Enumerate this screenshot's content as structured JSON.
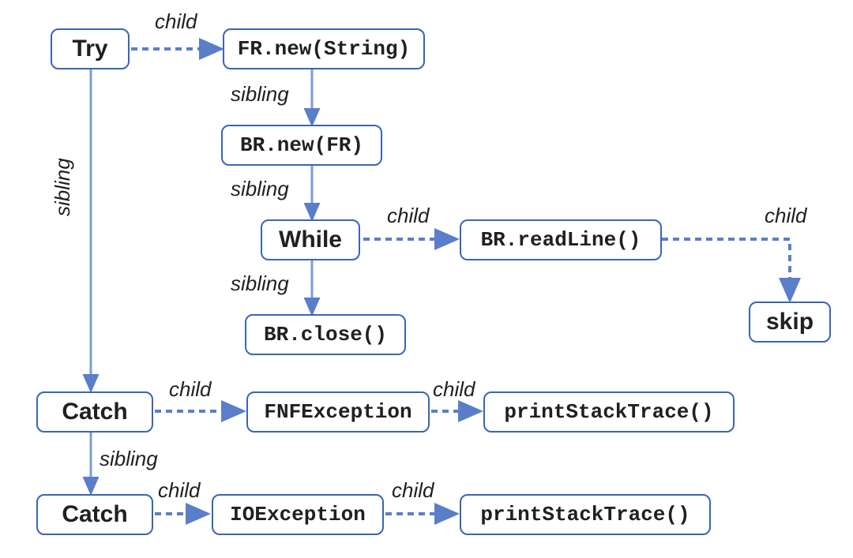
{
  "nodes": {
    "try": "Try",
    "frnew": "FR.new(String)",
    "brnew": "BR.new(FR)",
    "while": "While",
    "readline": "BR.readLine()",
    "skip": "skip",
    "brclose": "BR.close()",
    "catch1": "Catch",
    "fnf": "FNFException",
    "pst1": "printStackTrace()",
    "catch2": "Catch",
    "ioex": "IOException",
    "pst2": "printStackTrace()"
  },
  "edges": {
    "e_try_frnew": "child",
    "e_frnew_brnew": "sibling",
    "e_brnew_while": "sibling",
    "e_while_readline": "child",
    "e_readline_skip": "child",
    "e_while_brclose": "sibling",
    "e_try_catch1": "sibling",
    "e_catch1_fnf": "child",
    "e_fnf_pst1": "child",
    "e_catch1_catch2": "sibling",
    "e_catch2_ioex": "child",
    "e_ioex_pst2": "child"
  },
  "colors": {
    "arrow": "#5a7ec9",
    "arrow_light": "#7d9add"
  },
  "chart_data": {
    "type": "graph",
    "title": "",
    "nodes": [
      {
        "id": "try",
        "label": "Try",
        "kind": "keyword"
      },
      {
        "id": "frnew",
        "label": "FR.new(String)",
        "kind": "call"
      },
      {
        "id": "brnew",
        "label": "BR.new(FR)",
        "kind": "call"
      },
      {
        "id": "while",
        "label": "While",
        "kind": "keyword"
      },
      {
        "id": "readline",
        "label": "BR.readLine()",
        "kind": "call"
      },
      {
        "id": "skip",
        "label": "skip",
        "kind": "keyword"
      },
      {
        "id": "brclose",
        "label": "BR.close()",
        "kind": "call"
      },
      {
        "id": "catch1",
        "label": "Catch",
        "kind": "keyword"
      },
      {
        "id": "fnf",
        "label": "FNFException",
        "kind": "type"
      },
      {
        "id": "pst1",
        "label": "printStackTrace()",
        "kind": "call"
      },
      {
        "id": "catch2",
        "label": "Catch",
        "kind": "keyword"
      },
      {
        "id": "ioex",
        "label": "IOException",
        "kind": "type"
      },
      {
        "id": "pst2",
        "label": "printStackTrace()",
        "kind": "call"
      }
    ],
    "edges": [
      {
        "from": "try",
        "to": "frnew",
        "label": "child",
        "style": "dashed"
      },
      {
        "from": "frnew",
        "to": "brnew",
        "label": "sibling",
        "style": "solid"
      },
      {
        "from": "brnew",
        "to": "while",
        "label": "sibling",
        "style": "solid"
      },
      {
        "from": "while",
        "to": "readline",
        "label": "child",
        "style": "dashed"
      },
      {
        "from": "readline",
        "to": "skip",
        "label": "child",
        "style": "dashed"
      },
      {
        "from": "while",
        "to": "brclose",
        "label": "sibling",
        "style": "solid"
      },
      {
        "from": "try",
        "to": "catch1",
        "label": "sibling",
        "style": "solid"
      },
      {
        "from": "catch1",
        "to": "fnf",
        "label": "child",
        "style": "dashed"
      },
      {
        "from": "fnf",
        "to": "pst1",
        "label": "child",
        "style": "dashed"
      },
      {
        "from": "catch1",
        "to": "catch2",
        "label": "sibling",
        "style": "solid"
      },
      {
        "from": "catch2",
        "to": "ioex",
        "label": "child",
        "style": "dashed"
      },
      {
        "from": "ioex",
        "to": "pst2",
        "label": "child",
        "style": "dashed"
      }
    ]
  }
}
